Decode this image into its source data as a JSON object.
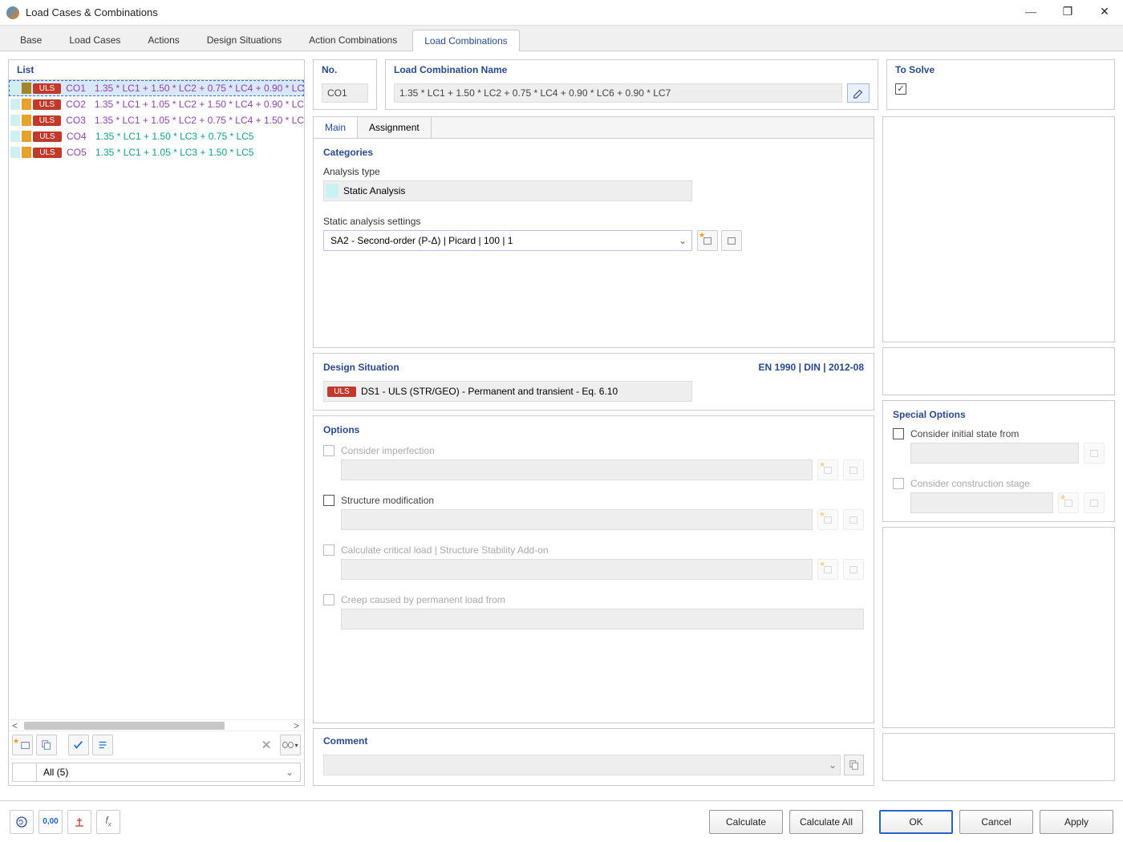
{
  "window": {
    "title": "Load Cases & Combinations"
  },
  "tabs": {
    "items": [
      "Base",
      "Load Cases",
      "Actions",
      "Design Situations",
      "Action Combinations",
      "Load Combinations"
    ],
    "active": 5
  },
  "list": {
    "header": "List",
    "filter": "All (5)",
    "rows": [
      {
        "id": "CO1",
        "formula": "1.35 * LC1 + 1.50 * LC2 + 0.75 * LC4 + 0.90 * LC",
        "tag": "ULS",
        "selected": true,
        "c1": "#cfeff0",
        "c2": "#a1862a"
      },
      {
        "id": "CO2",
        "formula": "1.35 * LC1 + 1.05 * LC2 + 1.50 * LC4 + 0.90 * LC",
        "tag": "ULS",
        "selected": false,
        "c1": "#cfeff0",
        "c2": "#eaa12a"
      },
      {
        "id": "CO3",
        "formula": "1.35 * LC1 + 1.05 * LC2 + 0.75 * LC4 + 1.50 * LC",
        "tag": "ULS",
        "selected": false,
        "c1": "#cfeff0",
        "c2": "#eaa12a"
      },
      {
        "id": "CO4",
        "formula": "1.35 * LC1 + 1.50 * LC3 + 0.75 * LC5",
        "tag": "ULS",
        "selected": false,
        "c1": "#cfeff0",
        "c2": "#eaa12a",
        "green": true
      },
      {
        "id": "CO5",
        "formula": "1.35 * LC1 + 1.05 * LC3 + 1.50 * LC5",
        "tag": "ULS",
        "selected": false,
        "c1": "#cfeff0",
        "c2": "#eaa12a",
        "green": true
      }
    ]
  },
  "header_fields": {
    "no_label": "No.",
    "no_value": "CO1",
    "name_label": "Load Combination Name",
    "name_value": "1.35 * LC1 + 1.50 * LC2 + 0.75 * LC4 + 0.90 * LC6 + 0.90 * LC7",
    "solve_label": "To Solve",
    "solve_checked": true
  },
  "subtabs": {
    "items": [
      "Main",
      "Assignment"
    ],
    "active": 0
  },
  "categories": {
    "title": "Categories",
    "analysis_type_label": "Analysis type",
    "analysis_type_value": "Static Analysis",
    "settings_label": "Static analysis settings",
    "settings_value": "SA2 - Second-order (P-Δ) | Picard | 100 | 1"
  },
  "design_situation": {
    "title": "Design Situation",
    "reference": "EN 1990 | DIN | 2012-08",
    "tag": "ULS",
    "value": "DS1 - ULS (STR/GEO) - Permanent and transient - Eq. 6.10"
  },
  "options": {
    "title": "Options",
    "imperfection": "Consider imperfection",
    "structure_mod": "Structure modification",
    "critical_load": "Calculate critical load | Structure Stability Add-on",
    "creep": "Creep caused by permanent load from"
  },
  "special_options": {
    "title": "Special Options",
    "initial_state": "Consider initial state from",
    "construction_stage": "Consider construction stage"
  },
  "comment": {
    "title": "Comment"
  },
  "footer": {
    "calculate": "Calculate",
    "calculate_all": "Calculate All",
    "ok": "OK",
    "cancel": "Cancel",
    "apply": "Apply"
  }
}
